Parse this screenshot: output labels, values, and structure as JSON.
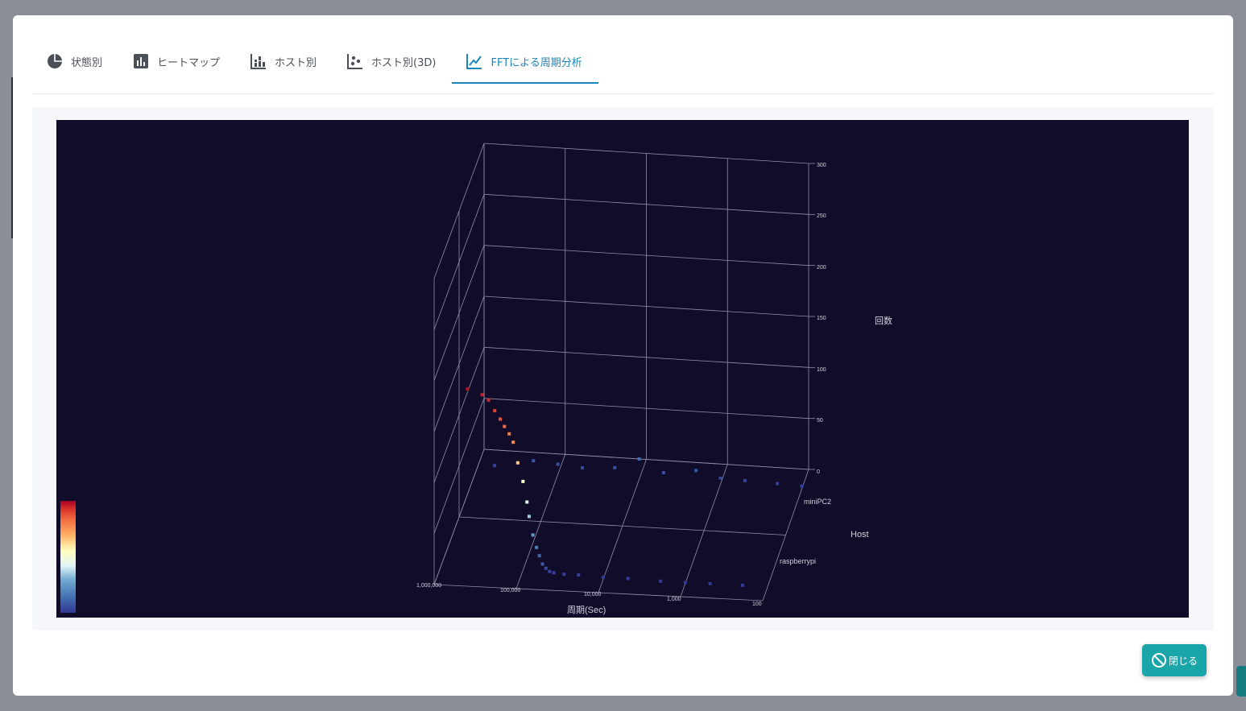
{
  "tabs": [
    {
      "label": "状態別",
      "icon": "pie-chart-icon"
    },
    {
      "label": "ヒートマップ",
      "icon": "bar-chart-icon"
    },
    {
      "label": "ホスト別",
      "icon": "stacked-bar-icon"
    },
    {
      "label": "ホスト別(3D)",
      "icon": "scatter-icon"
    },
    {
      "label": "FFTによる周期分析",
      "icon": "line-chart-icon",
      "active": true
    }
  ],
  "close_button": {
    "label": "閉じる",
    "icon": "ban-icon"
  },
  "colors": {
    "accent": "#1a86b9",
    "plot_bg": "#100c2a",
    "button": "#1aa5a8",
    "colorscale": [
      "#313695",
      "#4575b4",
      "#74add1",
      "#e0f3f8",
      "#ffffbf",
      "#fdae61",
      "#f46d43",
      "#d73027",
      "#a50026"
    ]
  },
  "chart_data": {
    "type": "scatter3d",
    "x_axis": {
      "label": "周期(Sec)",
      "scale": "log",
      "tick_labels": [
        "1,000,000",
        "100,000",
        "10,000",
        "1,000",
        "100"
      ]
    },
    "y_axis": {
      "label": "Host",
      "tick_labels": [
        "miniPC2",
        "raspberrypi"
      ]
    },
    "z_axis": {
      "label": "回数",
      "range": [
        0,
        300
      ],
      "tick_labels": [
        "0",
        "50",
        "100",
        "150",
        "200",
        "250",
        "300"
      ]
    },
    "colorbar": {
      "ticks": false,
      "range": [
        0,
        300
      ]
    },
    "series": [
      {
        "host": "raspberrypi",
        "points": [
          {
            "period": 450000,
            "count": 180
          },
          {
            "period": 300000,
            "count": 175
          },
          {
            "period": 250000,
            "count": 170
          },
          {
            "period": 210000,
            "count": 160
          },
          {
            "period": 180000,
            "count": 152
          },
          {
            "period": 160000,
            "count": 145
          },
          {
            "period": 140000,
            "count": 138
          },
          {
            "period": 125000,
            "count": 130
          },
          {
            "period": 110000,
            "count": 110
          },
          {
            "period": 95000,
            "count": 92
          },
          {
            "period": 85000,
            "count": 72
          },
          {
            "period": 80000,
            "count": 58
          },
          {
            "period": 72000,
            "count": 40
          },
          {
            "period": 65000,
            "count": 28
          },
          {
            "period": 60000,
            "count": 20
          },
          {
            "period": 55000,
            "count": 12
          },
          {
            "period": 50000,
            "count": 8
          },
          {
            "period": 45000,
            "count": 5
          },
          {
            "period": 40000,
            "count": 4
          },
          {
            "period": 30000,
            "count": 3
          },
          {
            "period": 20000,
            "count": 3
          },
          {
            "period": 10000,
            "count": 2
          },
          {
            "period": 5000,
            "count": 2
          },
          {
            "period": 2000,
            "count": 1
          },
          {
            "period": 1000,
            "count": 1
          },
          {
            "period": 500,
            "count": 1
          },
          {
            "period": 200,
            "count": 1
          }
        ]
      },
      {
        "host": "miniPC2",
        "points": [
          {
            "period": 600000,
            "count": 5
          },
          {
            "period": 200000,
            "count": 12
          },
          {
            "period": 100000,
            "count": 10
          },
          {
            "period": 50000,
            "count": 8
          },
          {
            "period": 20000,
            "count": 10
          },
          {
            "period": 10000,
            "count": 20
          },
          {
            "period": 5000,
            "count": 8
          },
          {
            "period": 2000,
            "count": 12
          },
          {
            "period": 1000,
            "count": 6
          },
          {
            "period": 500,
            "count": 5
          },
          {
            "period": 200,
            "count": 4
          },
          {
            "period": 100,
            "count": 3
          }
        ]
      }
    ]
  }
}
